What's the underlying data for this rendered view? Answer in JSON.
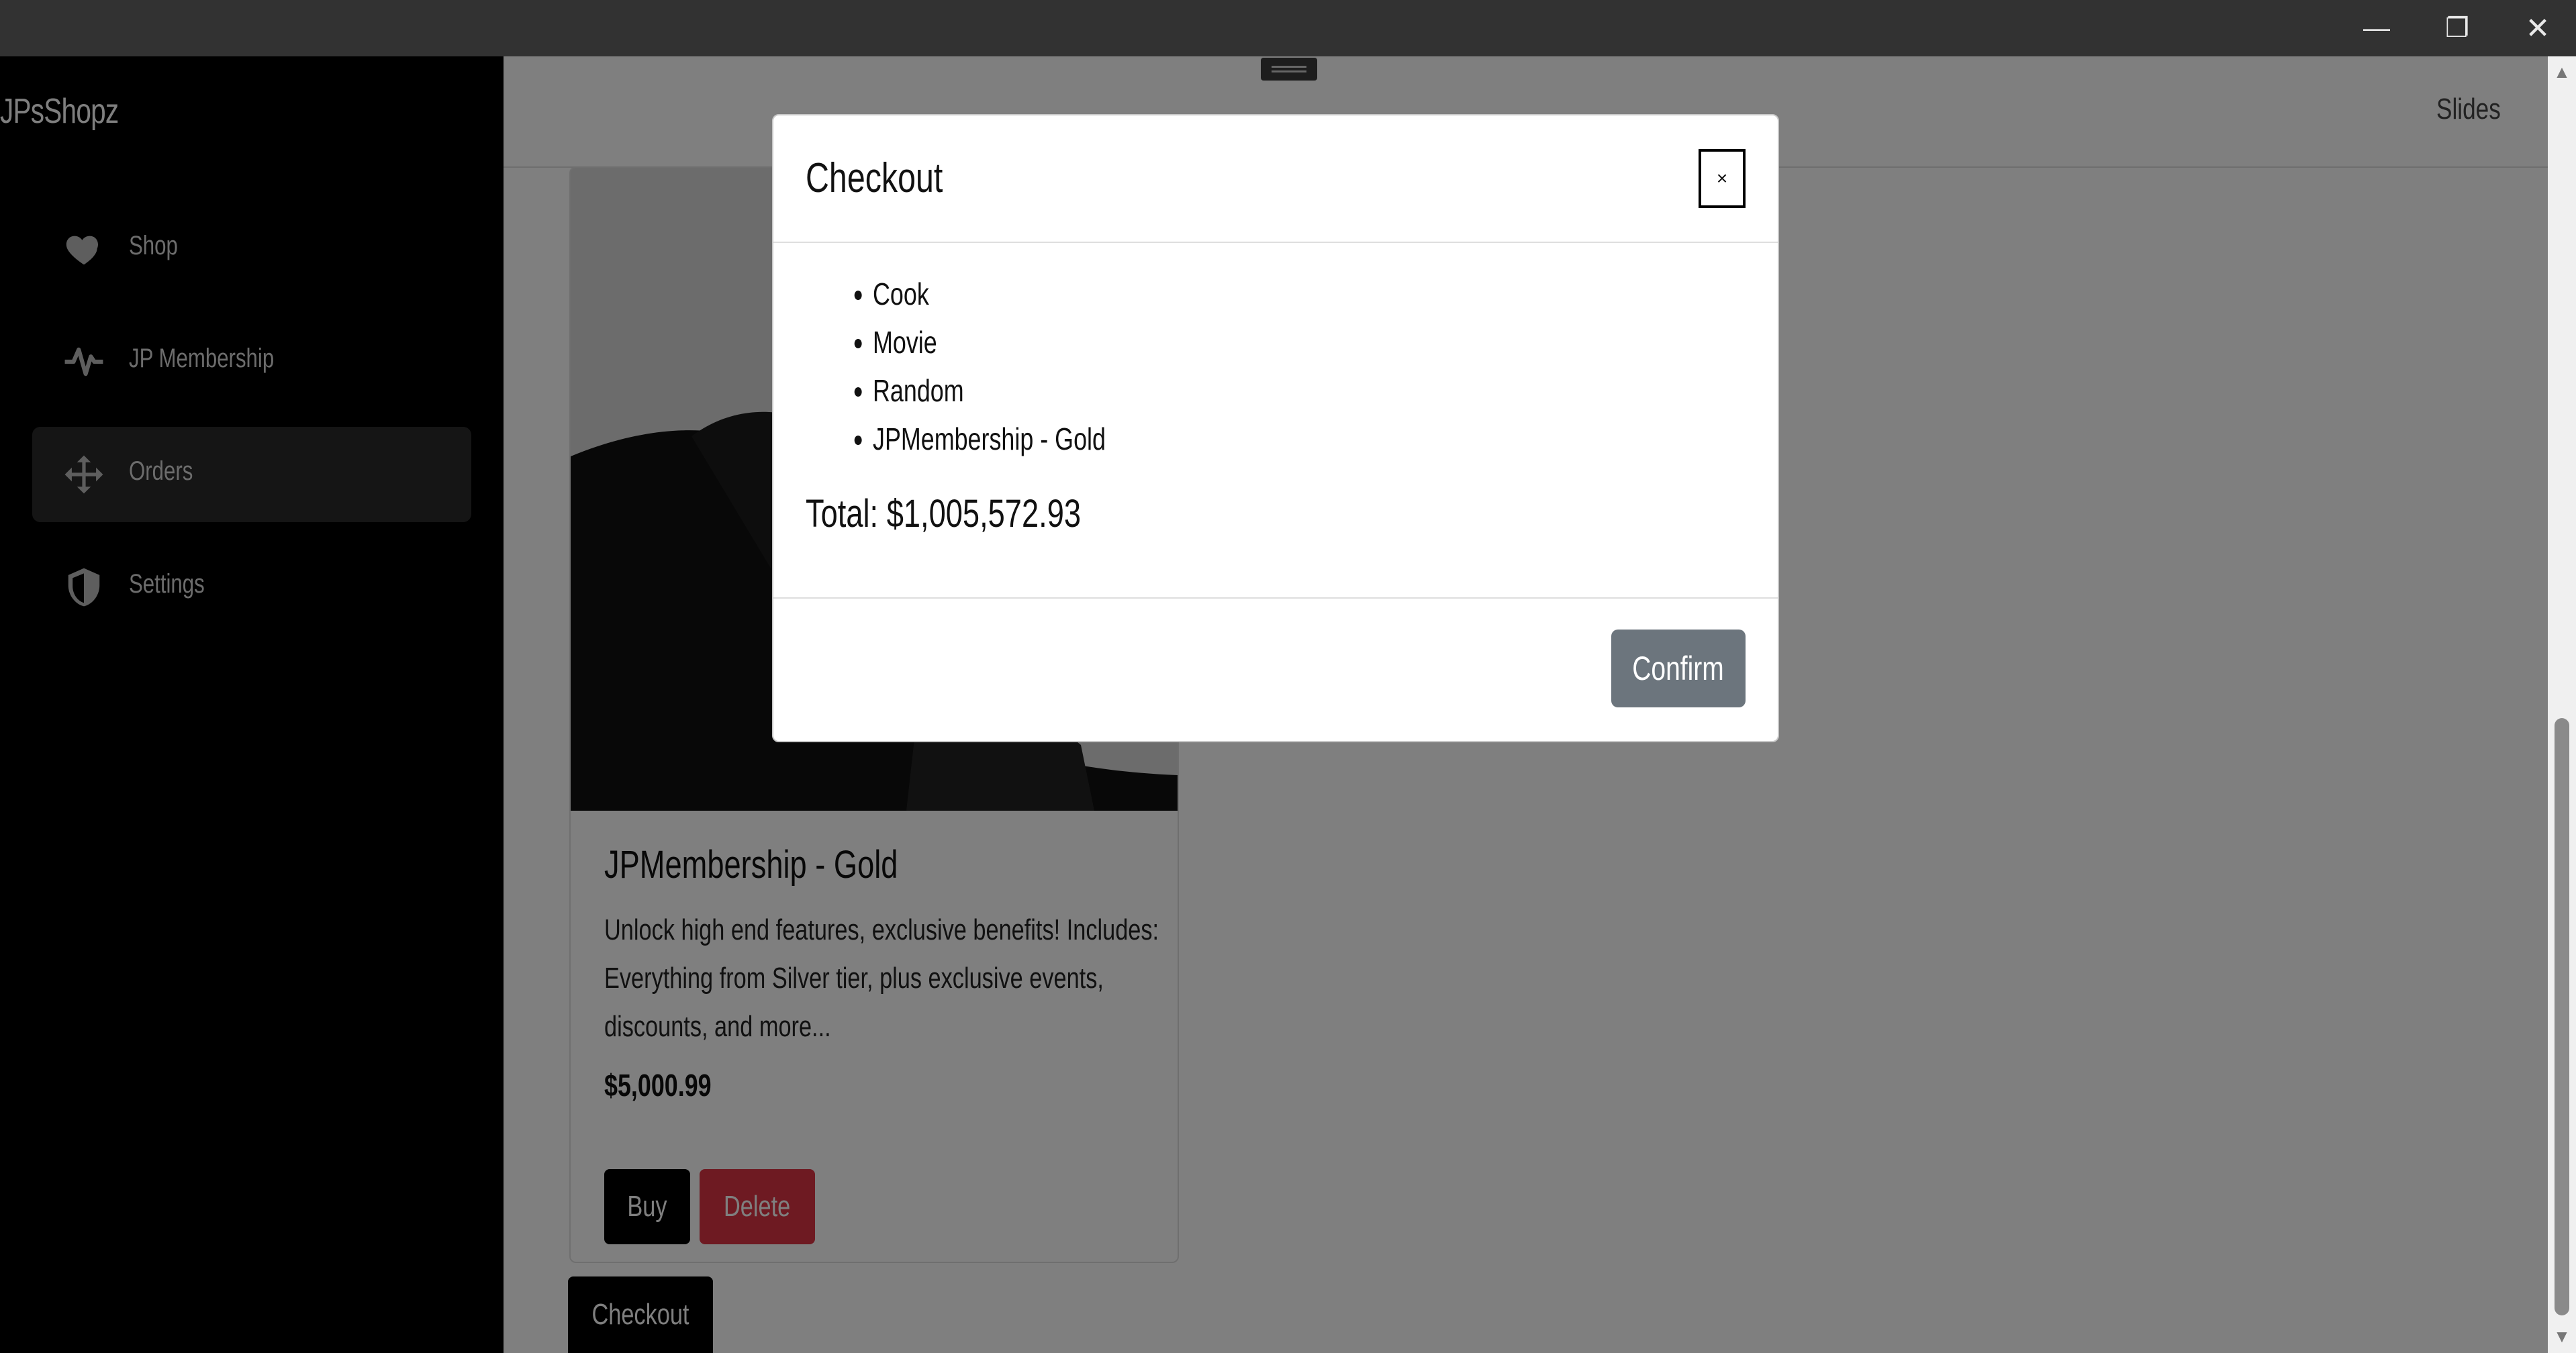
{
  "window": {
    "minimize_glyph": "—",
    "maximize_glyph": "❐",
    "close_glyph": "✕"
  },
  "sidebar": {
    "brand": "JPsShopz",
    "items": [
      {
        "label": "Shop",
        "icon": "heart-icon",
        "active": false
      },
      {
        "label": "JP Membership",
        "icon": "pulse-icon",
        "active": false
      },
      {
        "label": "Orders",
        "icon": "move-arrows-icon",
        "active": true
      },
      {
        "label": "Settings",
        "icon": "shield-icon",
        "active": false
      }
    ]
  },
  "topbar": {
    "slides_label": "Slides"
  },
  "card": {
    "title": "JPMembership - Gold",
    "description": "Unlock high end features, exclusive benefits! Includes: Everything from Silver tier, plus exclusive events, discounts, and more...",
    "price": "$5,000.99",
    "buy_label": "Buy",
    "delete_label": "Delete"
  },
  "checkout_label": "Checkout",
  "modal": {
    "title": "Checkout",
    "close_glyph": "×",
    "items": [
      "Cook",
      "Movie",
      "Random",
      "JPMembership - Gold"
    ],
    "total": "Total: $1,005,572.93",
    "confirm_label": "Confirm"
  },
  "colors": {
    "sidebar_bg": "#000000",
    "active_nav_bg": "#2a2a2a",
    "delete_red": "#dc3545",
    "confirm_gray": "#6c757d",
    "overlay": "rgba(0,0,0,0.5)"
  }
}
